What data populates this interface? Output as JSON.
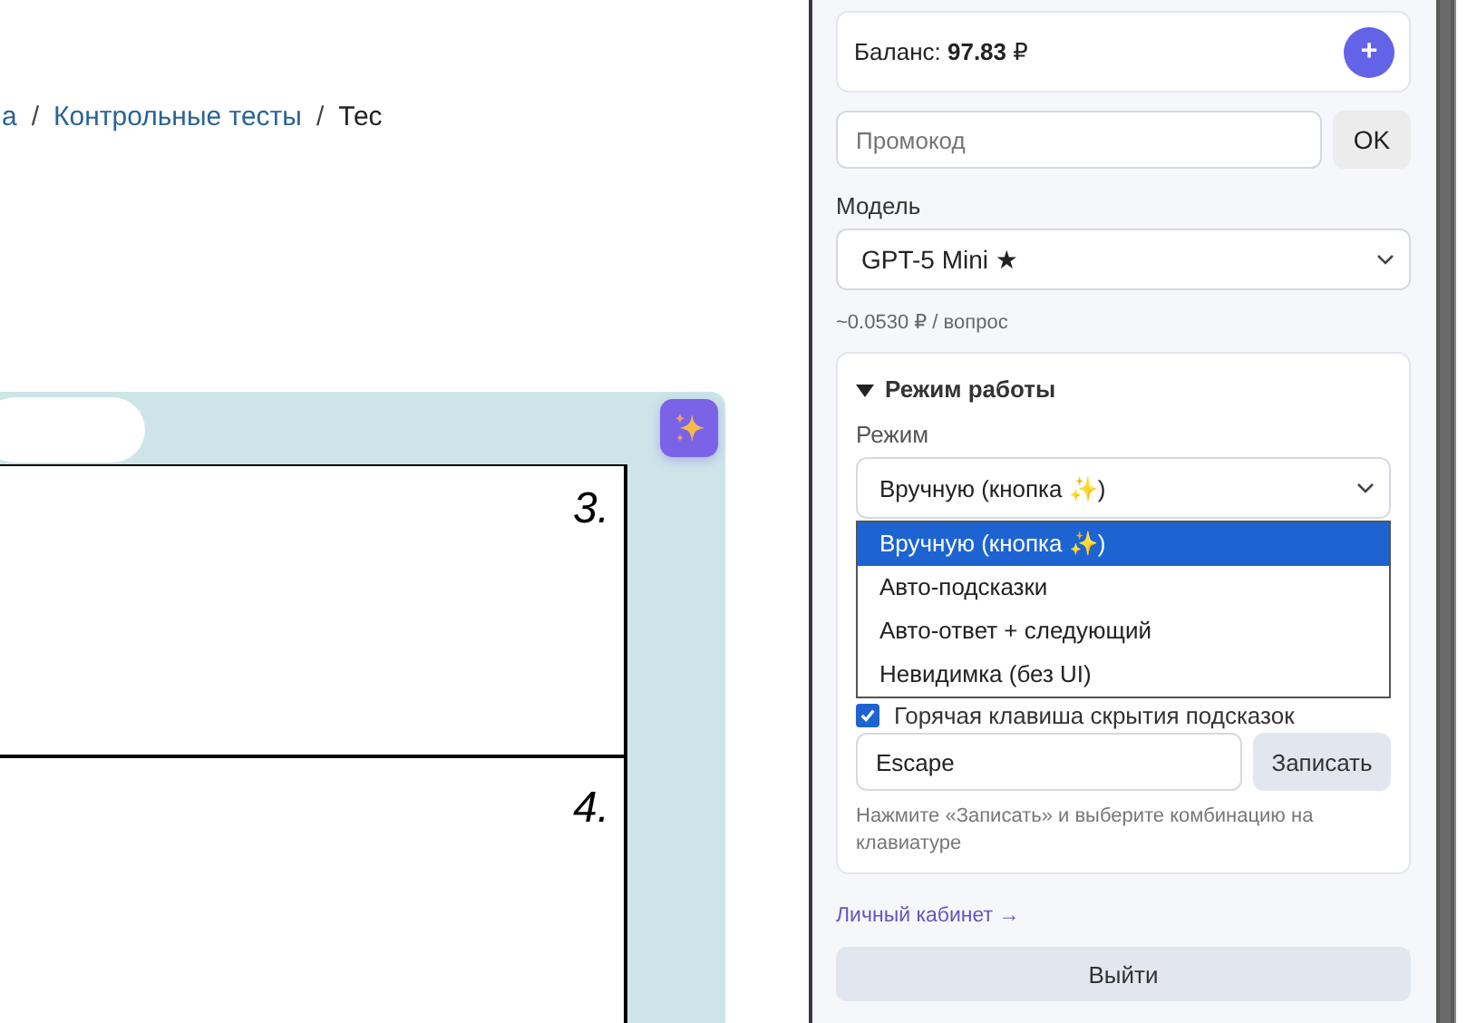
{
  "breadcrumb": {
    "separator": "/",
    "items": [
      {
        "label": "а",
        "link": true
      },
      {
        "label": "Контрольные тесты",
        "link": true
      },
      {
        "label": "Тес",
        "link": false
      }
    ]
  },
  "question_card": {
    "numbers": [
      "3.",
      "4."
    ]
  },
  "panel": {
    "balance": {
      "text": "Баланс: **97.83** ₽",
      "add_button": "+"
    },
    "promo": {
      "placeholder": "Промокод",
      "button": "OK"
    },
    "model": {
      "label": "Модель",
      "value": "GPT-5 Mini ★",
      "cost": "~0.0530 ₽ / вопрос"
    },
    "mode_section": {
      "title": "Режим работы",
      "expanded": true,
      "mode_label": "Режим",
      "value": "Вручную (кнопка ✨)",
      "dropdown_open": true,
      "options": [
        {
          "label": "Вручную (кнопка ✨)",
          "selected": true
        },
        {
          "label": "Авто-подсказки",
          "selected": false
        },
        {
          "label": "Авто-ответ + следующий",
          "selected": false
        },
        {
          "label": "Невидимка (без UI)",
          "selected": false
        }
      ],
      "hotkey_checkbox": {
        "label": "Горячая клавиша скрытия подсказок",
        "checked": true
      },
      "hotkey_value": "Escape",
      "record_button": "Записать",
      "hint": "Нажмите «Записать» и выберите комбинацию на клавиатуре"
    },
    "account_link": "Личный кабинет →",
    "logout_button": "Выйти"
  }
}
